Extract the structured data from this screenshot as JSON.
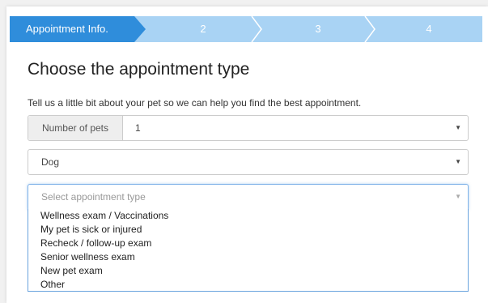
{
  "stepper": {
    "steps": [
      {
        "label": "Appointment Info."
      },
      {
        "label": "2"
      },
      {
        "label": "3"
      },
      {
        "label": "4"
      }
    ]
  },
  "form": {
    "title": "Choose the appointment type",
    "description": "Tell us a little bit about your pet so we can help you find the best appointment.",
    "pets_label": "Number of pets",
    "pets_value": "1",
    "species_value": "Dog",
    "type_placeholder": "Select appointment type",
    "options": [
      "Wellness exam / Vaccinations",
      "My pet is sick or injured",
      "Recheck / follow-up exam",
      "Senior wellness exam",
      "New pet exam",
      "Other"
    ]
  },
  "colors": {
    "step_active": "#2f8ddb",
    "step_inactive": "#a9d3f4",
    "focus_border": "#6aa3de"
  },
  "icons": {
    "dropdown": "caret-down-icon",
    "step_separator": "chevron-right-icon"
  }
}
